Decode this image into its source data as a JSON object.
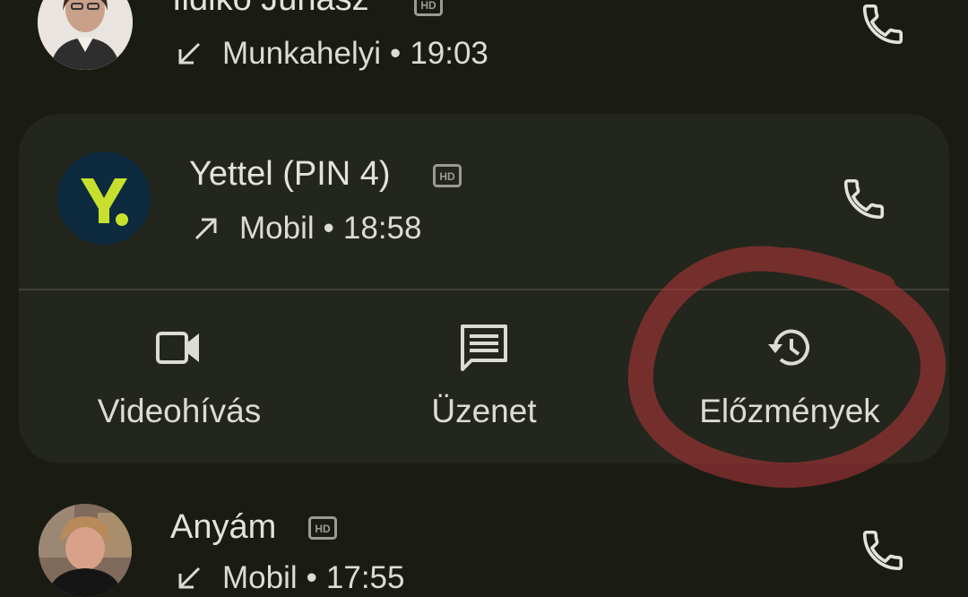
{
  "calls": [
    {
      "name": "Ildikó Juhász",
      "type": "Munkahelyi",
      "time": "19:03",
      "direction": "incoming",
      "avatar": "photo"
    },
    {
      "name": "Yettel (PIN 4)",
      "type": "Mobil",
      "time": "18:58",
      "direction": "outgoing",
      "avatar": "Y.",
      "expanded": true
    },
    {
      "name": "Anyám",
      "type": "Mobil",
      "time": "17:55",
      "direction": "incoming",
      "avatar": "photo"
    }
  ],
  "separator": "•",
  "badge": "HD",
  "actions": [
    {
      "label": "Videohívás",
      "icon": "video-camera-icon"
    },
    {
      "label": "Üzenet",
      "icon": "message-icon"
    },
    {
      "label": "Előzmények",
      "icon": "history-icon"
    }
  ],
  "colors": {
    "background": "#1a1c14",
    "card": "#23261d",
    "yettel_bg": "#0d2a3e",
    "yettel_fg": "#c7e02d",
    "annotation": "#b8363a"
  }
}
